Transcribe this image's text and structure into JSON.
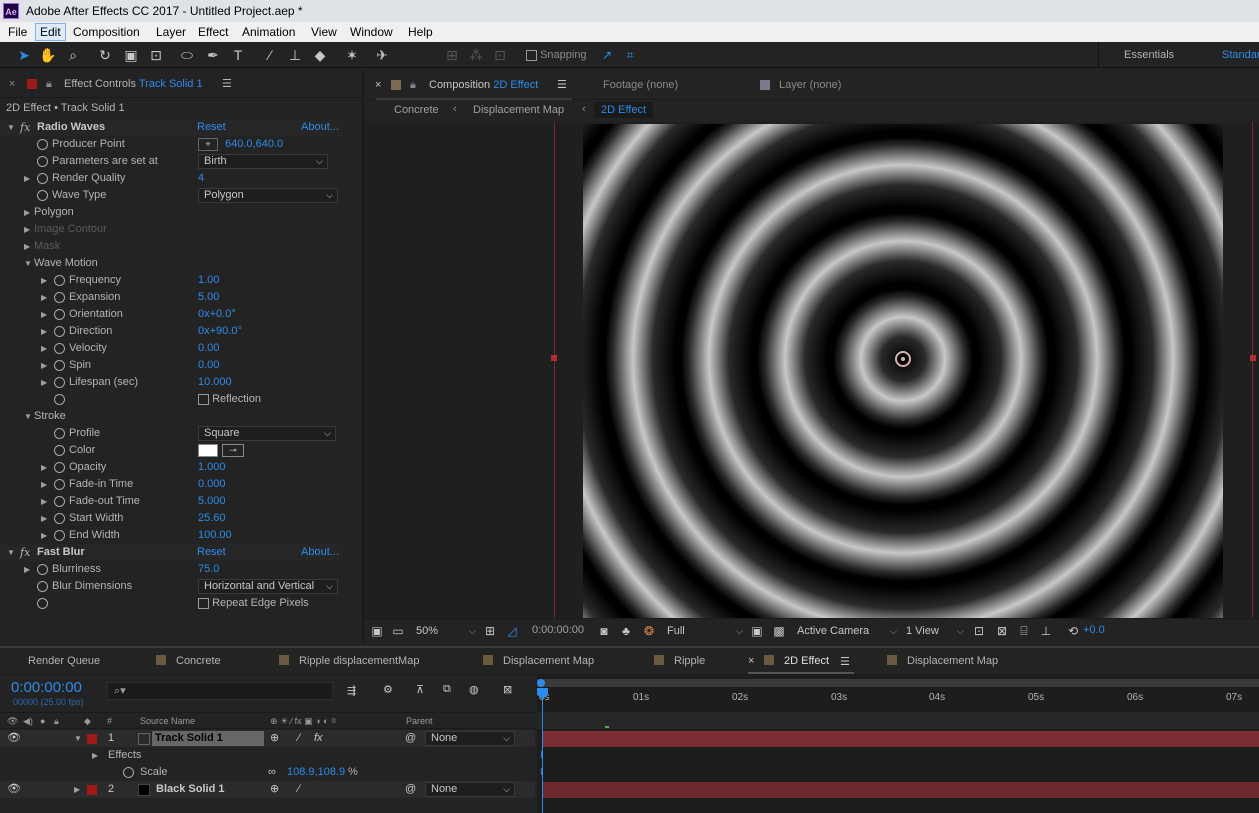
{
  "app": {
    "logo": "Ae",
    "title": "Adobe After Effects CC 2017 - Untitled Project.aep *"
  },
  "menu": [
    "File",
    "Edit",
    "Composition",
    "Layer",
    "Effect",
    "Animation",
    "View",
    "Window",
    "Help"
  ],
  "toolbar": {
    "snapping": "Snapping",
    "workspace": "Essentials",
    "workspace2": "Standard"
  },
  "effect_controls": {
    "tab_label": "Effect Controls",
    "layer": "Track Solid 1",
    "subtitle": "2D Effect • Track Solid 1",
    "radio_waves": {
      "name": "Radio Waves",
      "reset": "Reset",
      "about": "About...",
      "producer_point_label": "Producer Point",
      "producer_point": "640.0,640.0",
      "parameters_label": "Parameters are set at",
      "parameters": "Birth",
      "render_quality_label": "Render Quality",
      "render_quality": "4",
      "wave_type_label": "Wave Type",
      "wave_type": "Polygon",
      "polygon": "Polygon",
      "image_contour": "Image Contour",
      "mask": "Mask",
      "wave_motion": "Wave Motion",
      "frequency_label": "Frequency",
      "frequency": "1.00",
      "expansion_label": "Expansion",
      "expansion": "5.00",
      "orientation_label": "Orientation",
      "orientation": "0x+0.0°",
      "direction_label": "Direction",
      "direction": "0x+90.0°",
      "velocity_label": "Velocity",
      "velocity": "0.00",
      "spin_label": "Spin",
      "spin": "0.00",
      "lifespan_label": "Lifespan (sec)",
      "lifespan": "10.000",
      "reflection": "Reflection",
      "stroke": "Stroke",
      "profile_label": "Profile",
      "profile": "Square",
      "color_label": "Color",
      "opacity_label": "Opacity",
      "opacity": "1.000",
      "fadein_label": "Fade-in Time",
      "fadein": "0.000",
      "fadeout_label": "Fade-out Time",
      "fadeout": "5.000",
      "startwidth_label": "Start Width",
      "startwidth": "25.60",
      "endwidth_label": "End Width",
      "endwidth": "100.00"
    },
    "fast_blur": {
      "name": "Fast Blur",
      "reset": "Reset",
      "about": "About...",
      "blurriness_label": "Blurriness",
      "blurriness": "75.0",
      "dimensions_label": "Blur Dimensions",
      "dimensions": "Horizontal and Vertical",
      "repeat": "Repeat Edge Pixels"
    }
  },
  "composition": {
    "tab_prefix": "Composition",
    "tab_name": "2D Effect",
    "footage": "Footage (none)",
    "layer": "Layer (none)",
    "crumbs": [
      "Concrete",
      "Displacement Map",
      "2D Effect"
    ],
    "zoom": "50%",
    "time": "0:00:00:00",
    "resolution": "Full",
    "camera": "Active Camera",
    "views": "1 View",
    "exposure": "+0.0"
  },
  "timeline": {
    "tabs": [
      "Render Queue",
      "Concrete",
      "Ripple displacementMap",
      "Displacement Map",
      "Ripple",
      "2D Effect",
      "Displacement Map"
    ],
    "timecode": "0:00:00:00",
    "frames": "00000 (25.00 fps)",
    "col_source": "Source Name",
    "col_parent": "Parent",
    "col_num": "#",
    "ruler": [
      "0s",
      "01s",
      "02s",
      "03s",
      "04s",
      "05s",
      "06s",
      "07s"
    ],
    "layers": [
      {
        "num": "1",
        "name": "Track Solid 1",
        "parent": "None",
        "color": "#38d838"
      },
      {
        "num": "2",
        "name": "Black Solid 1",
        "parent": "None",
        "color": "#000000"
      }
    ],
    "effects": "Effects",
    "scale_label": "Scale",
    "scale": "108.9,108.9",
    "scale_unit": "%"
  }
}
